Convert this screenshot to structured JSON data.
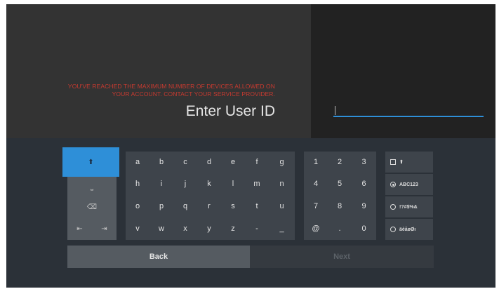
{
  "error": {
    "line1": "YOU'VE REACHED THE MAXIMUM NUMBER OF DEVICES ALLOWED ON",
    "line2": "YOUR ACCOUNT. CONTACT YOUR SERVICE PROVIDER."
  },
  "title": "Enter User ID",
  "field": {
    "value": ""
  },
  "keyboard": {
    "shift_glyph": "⬆",
    "space_glyph": "⎵",
    "backspace_glyph": "⌫",
    "cursor_left_glyph": "⇤",
    "cursor_right_glyph": "⇥",
    "letters": [
      [
        "a",
        "b",
        "c",
        "d",
        "e",
        "f",
        "g"
      ],
      [
        "h",
        "i",
        "j",
        "k",
        "l",
        "m",
        "n"
      ],
      [
        "o",
        "p",
        "q",
        "r",
        "s",
        "t",
        "u"
      ],
      [
        "v",
        "w",
        "x",
        "y",
        "z",
        "-",
        "_"
      ]
    ],
    "numbers": [
      [
        "1",
        "2",
        "3"
      ],
      [
        "4",
        "5",
        "6"
      ],
      [
        "7",
        "8",
        "9"
      ],
      [
        "@",
        ".",
        "0"
      ]
    ],
    "options": {
      "caps_glyph": "⬆",
      "alnum": "ABC123",
      "symbols": "!?#$%&",
      "accents": "äèåøØı"
    }
  },
  "buttons": {
    "back": "Back",
    "next": "Next"
  },
  "colors": {
    "accent": "#2e8fd8",
    "error": "#c83a30"
  }
}
